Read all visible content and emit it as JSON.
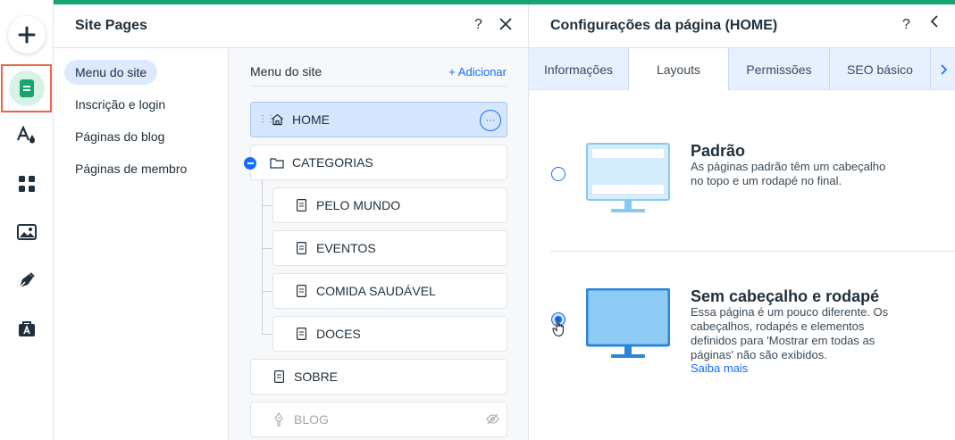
{
  "rail": {
    "items": [
      "add-icon",
      "pages-icon",
      "theme-icon",
      "apps-icon",
      "media-icon",
      "blog-pen-icon",
      "business-icon"
    ]
  },
  "site_pages": {
    "title": "Site Pages",
    "help": "?",
    "close": "✕",
    "nav": [
      "Menu do site",
      "Inscrição e login",
      "Páginas do blog",
      "Páginas de membro"
    ],
    "tree_title": "Menu do site",
    "add_label": "Adicionar",
    "add_plus": "+",
    "more": "···",
    "pages": {
      "home": "HOME",
      "categorias": "CATEGORIAS",
      "pelo_mundo": "PELO MUNDO",
      "eventos": "EVENTOS",
      "comida": "COMIDA SAUDÁVEL",
      "doces": "DOCES",
      "sobre": "SOBRE",
      "blog": "BLOG"
    }
  },
  "page_settings": {
    "title": "Configurações da página (HOME)",
    "help": "?",
    "back": "‹",
    "tabs": [
      "Informações",
      "Layouts",
      "Permissões",
      "SEO básico"
    ],
    "next": "›",
    "options": [
      {
        "title": "Padrão",
        "desc": "As páginas padrão têm um cabeçalho no topo e um rodapé no final.",
        "selected": false
      },
      {
        "title": "Sem cabeçalho e rodapé",
        "desc": "Essa página é um pouco diferente. Os cabeçalhos, rodapés e elementos definidos para 'Mostrar em todas as páginas' não são exibidos.",
        "link": "Saiba mais",
        "selected": true
      }
    ]
  },
  "colors": {
    "accent": "#116dff",
    "brand_bar": "#17a572",
    "highlight": "#e8644a"
  }
}
